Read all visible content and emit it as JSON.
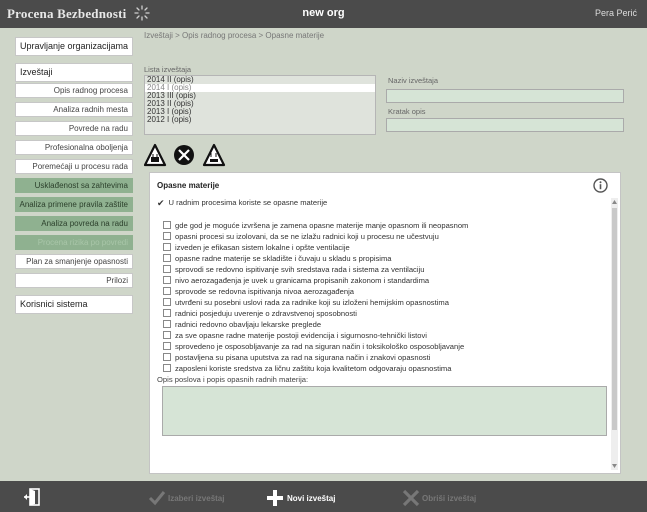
{
  "header": {
    "brand": "Procena Bezbednosti",
    "org_name": "new org",
    "user": "Pera Perić"
  },
  "sidebar": {
    "top_item_1": "Upravljanje organizacijama",
    "top_item_2": "Izveštaji",
    "sub_items": [
      {
        "label": "Opis radnog procesa",
        "state": "normal"
      },
      {
        "label": "Analiza radnih mesta",
        "state": "normal"
      },
      {
        "label": "Povrede na radu",
        "state": "normal"
      },
      {
        "label": "Profesionalna oboljenja",
        "state": "normal"
      },
      {
        "label": "Poremećaji u procesu rada",
        "state": "normal"
      },
      {
        "label": "Usklađenost sa zahtevima",
        "state": "active"
      },
      {
        "label": "Analiza primene pravila zaštite",
        "state": "active"
      },
      {
        "label": "Analiza povreda na radu",
        "state": "active"
      },
      {
        "label": "Procena rizika po povredi",
        "state": "disabled"
      },
      {
        "label": "Plan za smanjenje opasnosti",
        "state": "normal"
      },
      {
        "label": "Prilozi",
        "state": "normal"
      }
    ],
    "bottom_item": "Korisnici sistema"
  },
  "main": {
    "breadcrumb": "Izveštaji > Opis radnog procesa > Opasne materije",
    "list_label": "Lista izveštaja",
    "list_items": [
      "2014 II (opis)",
      "2014 I (opis)",
      "2013 III (opis)",
      "2013 II (opis)",
      "2013 I (opis)",
      "2012 I (opis)"
    ],
    "selected_index": 1,
    "naziv_label": "Naziv izveštaja",
    "naziv_value": "",
    "kratak_label": "Kratak opis",
    "kratak_value": "",
    "section_title": "Opasne materije",
    "main_check_label": "U radnim procesima koriste se opasne materije",
    "check_items": [
      "gde god je moguće izvršena je zamena opasne materije manje opasnom ili neopasnom",
      "opasni procesi su izolovani, da se ne izlažu radnici koji u procesu ne učestvuju",
      "izveden je efikasan sistem lokalne i opšte ventilacije",
      "opasne radne materije se skladište i čuvaju u skladu s propisima",
      "sprovodi se redovno ispitivanje svih sredstava rada i sistema za ventilaciju",
      "nivo aerozagađenja je uvek u granicama propisanih zakonom i standardima",
      "sprovode se redovna ispitivanja nivoa aerozagađenja",
      "utvrđeni su posebni uslovi rada za radnike koji su izloženi hemijskim opasnostima",
      "radnici posjeduju uverenje o zdravstvenoj sposobnosti",
      "radnici redovno obavljaju lekarske preglede",
      "za sve opasne radne materije postoji evidencija i sigurnosno-tehnički listovi",
      "sprovedeno je osposobljavanje za rad na siguran način i toksikološko osposobljavanje",
      "postavljena su pisana uputstva za rad na sigurana način i znakovi opasnosti",
      "zaposleni koriste sredstva za ličnu zaštitu koja kvalitetom odgovaraju opasnostima"
    ],
    "opis_label": "Opis poslova i popis opasnih radnih materija:",
    "opis_value": ""
  },
  "bottom": {
    "select_label": "Izaberi izveštaj",
    "new_label": "Novi izveštaj",
    "delete_label": "Obriši izveštaj"
  },
  "colors": {
    "accent_green": "#8fb190",
    "bar_dark": "#4b4b4b",
    "page_bg": "#cfd6c9"
  }
}
